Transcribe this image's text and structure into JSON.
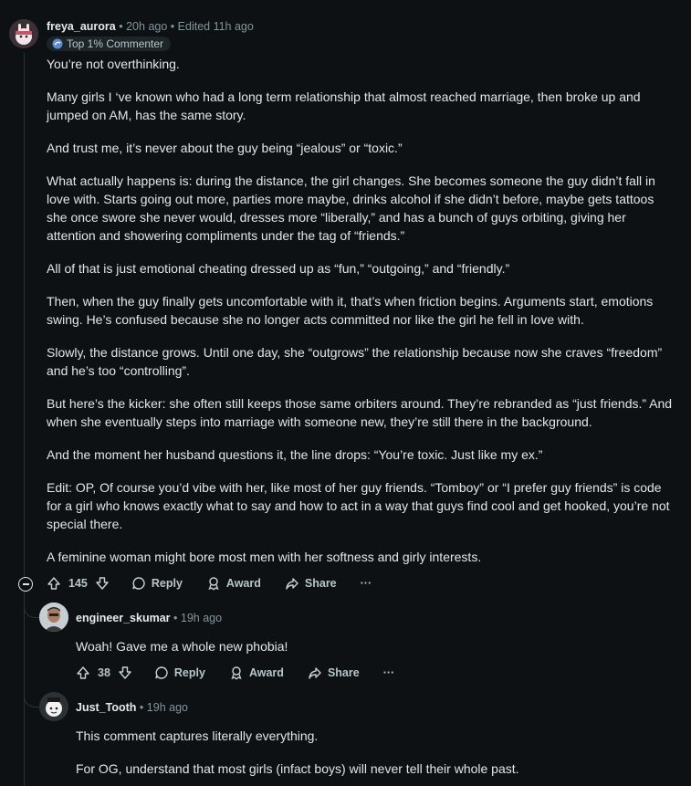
{
  "comment": {
    "username": "freya_aurora",
    "time": "20h ago",
    "edited": "Edited 11h ago",
    "badge": "Top 1% Commenter",
    "paragraphs": [
      "You’re not overthinking.",
      "Many girls I ‘ve known who had a long term relationship that almost reached marriage, then broke up and jumped on AM, has the same story.",
      "And trust me, it’s never about the guy being “jealous” or “toxic.”",
      "What actually happens is: during the distance, the girl changes. She becomes someone the guy didn’t fall in love with. Starts going out more, parties more maybe, drinks alcohol if she didn’t before, maybe gets tattoos she once swore she never would, dresses more “liberally,” and has a bunch of guys orbiting, giving her attention and showering compliments under the tag of “friends.”",
      "All of that is just emotional cheating dressed up as “fun,” “outgoing,” and “friendly.”",
      "Then, when the guy finally gets uncomfortable with it, that’s when friction begins. Arguments start, emotions swing. He’s confused because she no longer acts committed nor like the girl he fell in love with.",
      "Slowly, the distance grows. Until one day, she “outgrows” the relationship because now she craves “freedom” and he’s too “controlling”.",
      "But here’s the kicker: she often still keeps those same orbiters around. They’re rebranded as “just friends.” And when she eventually steps into marriage with someone new, they’re still there in the background.",
      "And the moment her husband questions it, the line drops: “You’re toxic. Just like my ex.”",
      "Edit: OP, Of course you’d vibe with her, like most of her guy friends. “Tomboy” or “I prefer guy friends” is code for a girl who knows exactly what to say and how to act in a way that guys find cool and get hooked, you’re not special there.",
      "A feminine woman might bore most men with her softness and girly interests."
    ],
    "votes": "145",
    "reply": "Reply",
    "award": "Award",
    "share": "Share",
    "more": "···"
  },
  "reply1": {
    "username": "engineer_skumar",
    "time": "19h ago",
    "text": "Woah! Gave me a whole new phobia!",
    "votes": "38",
    "reply": "Reply",
    "award": "Award",
    "share": "Share",
    "more": "···"
  },
  "reply2": {
    "username": "Just_Tooth",
    "time": "19h ago",
    "paragraphs": [
      "This comment captures literally everything.",
      "For OG, understand that most girls (infact boys) will never tell their whole past."
    ]
  },
  "separator": "•",
  "colors": {
    "background": "#0e1113",
    "text": "#e2e6e8",
    "meta": "#82959b",
    "thread": "#2a3236"
  }
}
